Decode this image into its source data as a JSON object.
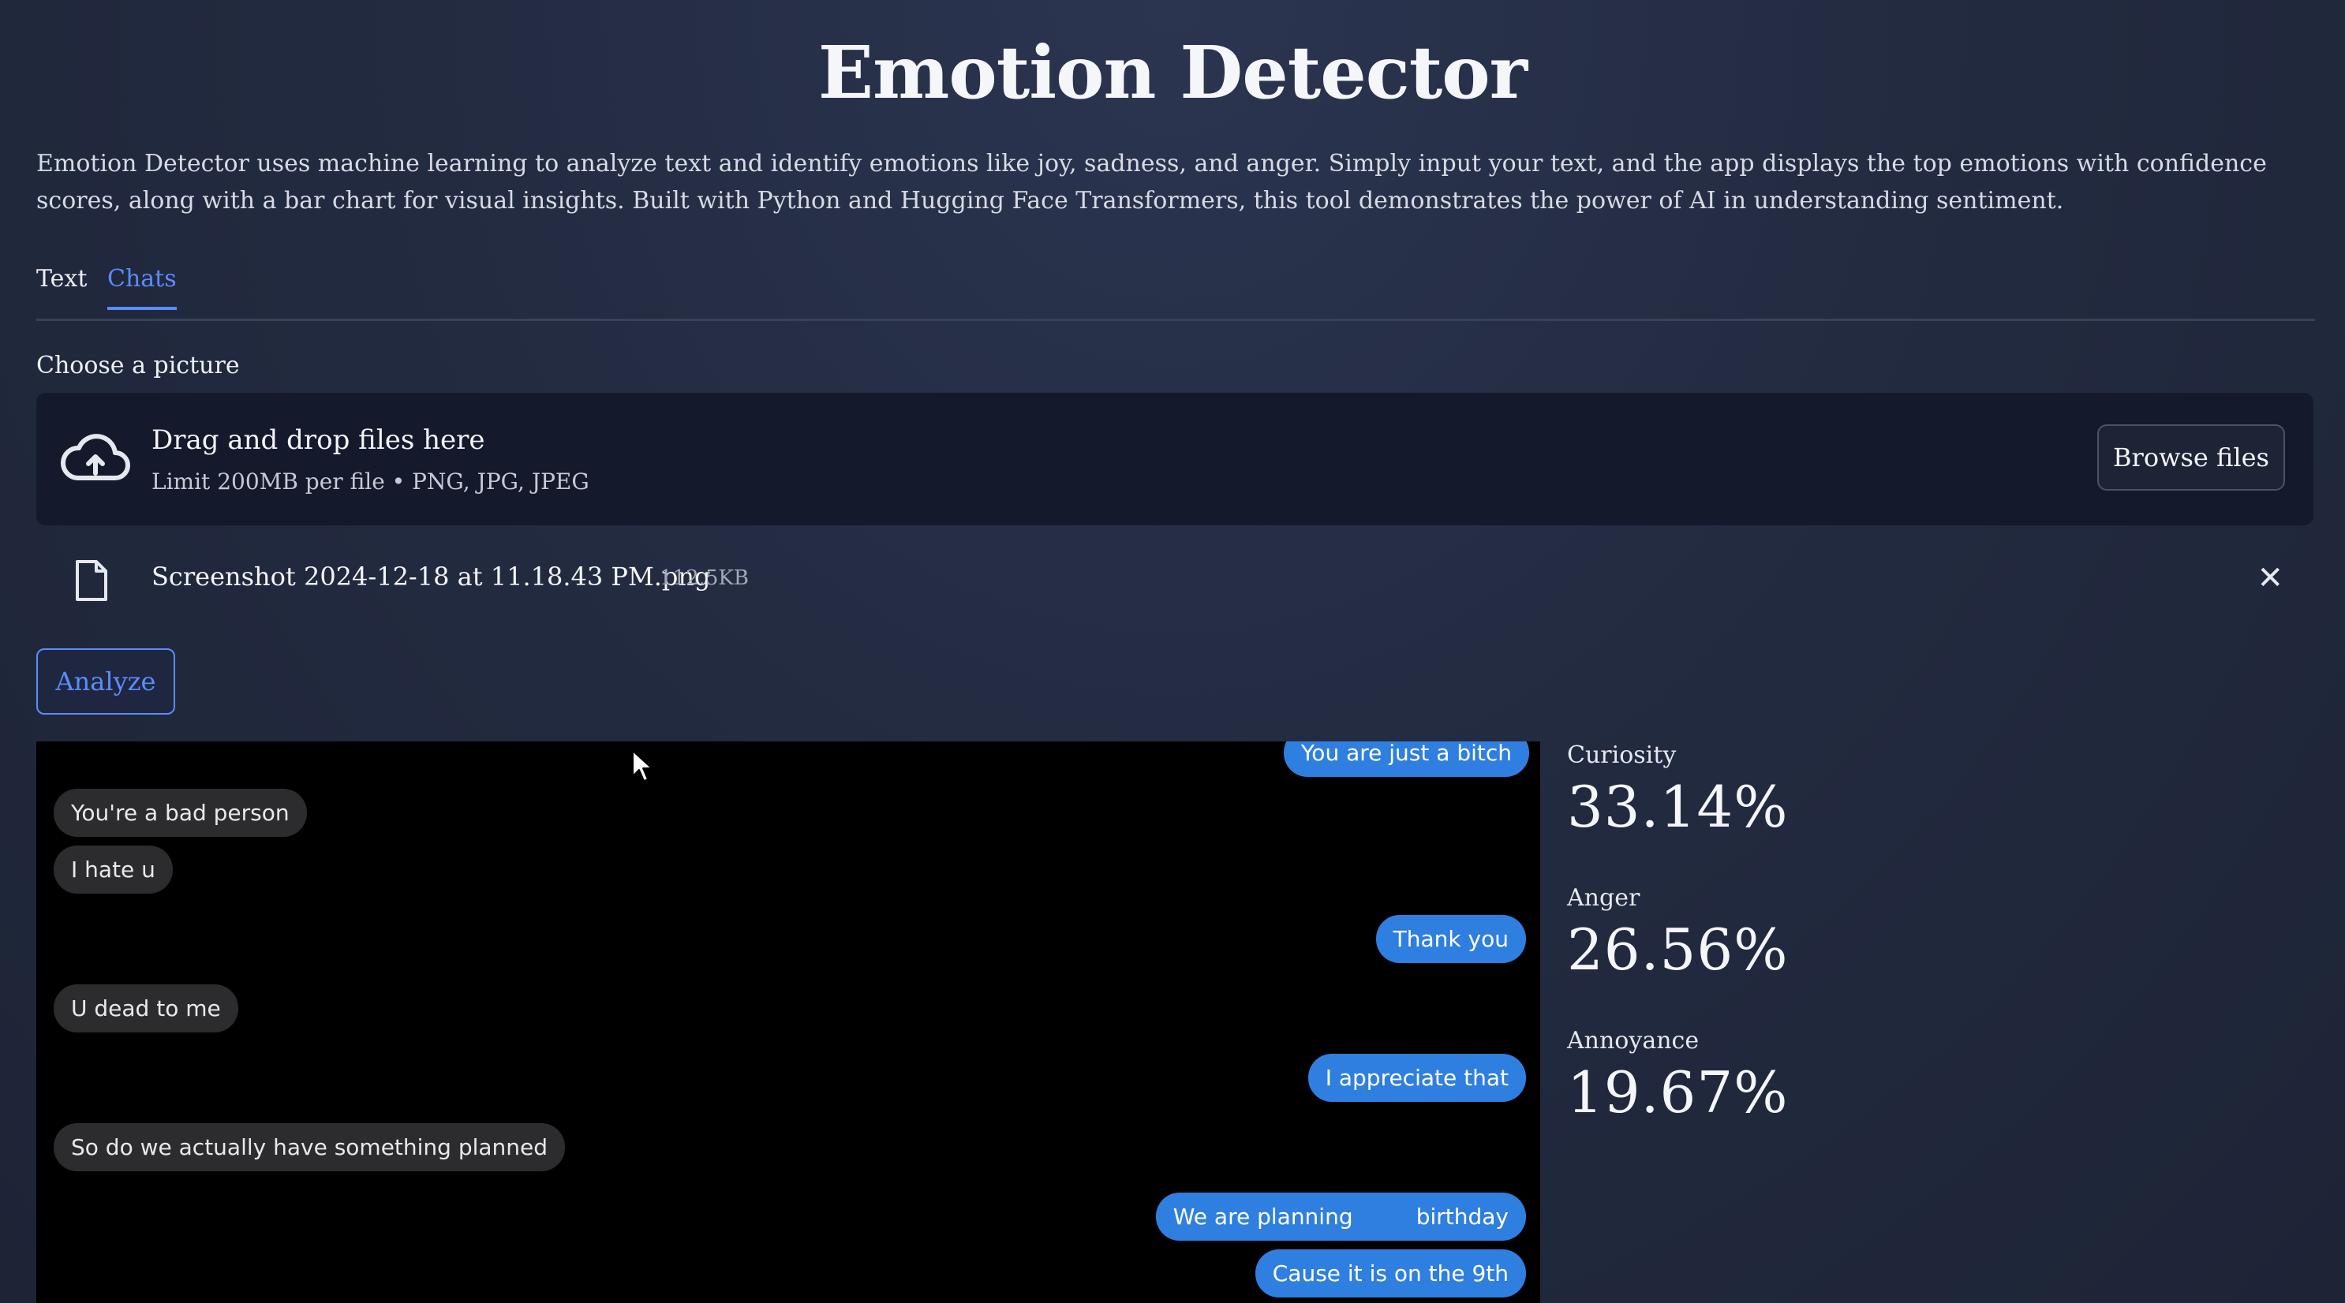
{
  "header": {
    "title": "Emotion Detector",
    "description": "Emotion Detector uses machine learning to analyze text and identify emotions like joy, sadness, and anger. Simply input your text, and the app displays the top emotions with confidence scores, along with a bar chart for visual insights. Built with Python and Hugging Face Transformers, this tool demonstrates the power of AI in understanding sentiment."
  },
  "tabs": [
    {
      "label": "Text",
      "active": false
    },
    {
      "label": "Chats",
      "active": true
    }
  ],
  "uploader": {
    "label": "Choose a picture",
    "drop_title": "Drag and drop files here",
    "drop_limit": "Limit 200MB per file • PNG, JPG, JPEG",
    "browse_label": "Browse files",
    "icon": "cloud-upload-icon"
  },
  "uploaded_file": {
    "name": "Screenshot 2024-12-18 at 11.18.43 PM.png",
    "size": "112.5KB",
    "icon": "file-icon",
    "remove_icon": "close-icon"
  },
  "analyze_label": "Analyze",
  "chat_messages": [
    {
      "text": "You are just a bitch",
      "direction": "outgoing"
    },
    {
      "text": "You're a bad person",
      "direction": "incoming"
    },
    {
      "text": "I hate u",
      "direction": "incoming"
    },
    {
      "text": "Thank you",
      "direction": "outgoing"
    },
    {
      "text": "U dead to me",
      "direction": "incoming"
    },
    {
      "text": "I appreciate that",
      "direction": "outgoing"
    },
    {
      "text": "So do we actually have something planned",
      "direction": "incoming"
    },
    {
      "text": "We are planning         birthday",
      "direction": "outgoing"
    },
    {
      "text": "Cause it is on the 9th",
      "direction": "outgoing"
    }
  ],
  "results": [
    {
      "label": "Curiosity",
      "value": "33.14%"
    },
    {
      "label": "Anger",
      "value": "26.56%"
    },
    {
      "label": "Annoyance",
      "value": "19.67%"
    }
  ],
  "colors": {
    "accent": "#5b8cff",
    "background": "#232b41",
    "dropzone": "#141a2c",
    "outgoing_bubble": "#2f7fe0",
    "incoming_bubble": "#2c2c2e"
  }
}
